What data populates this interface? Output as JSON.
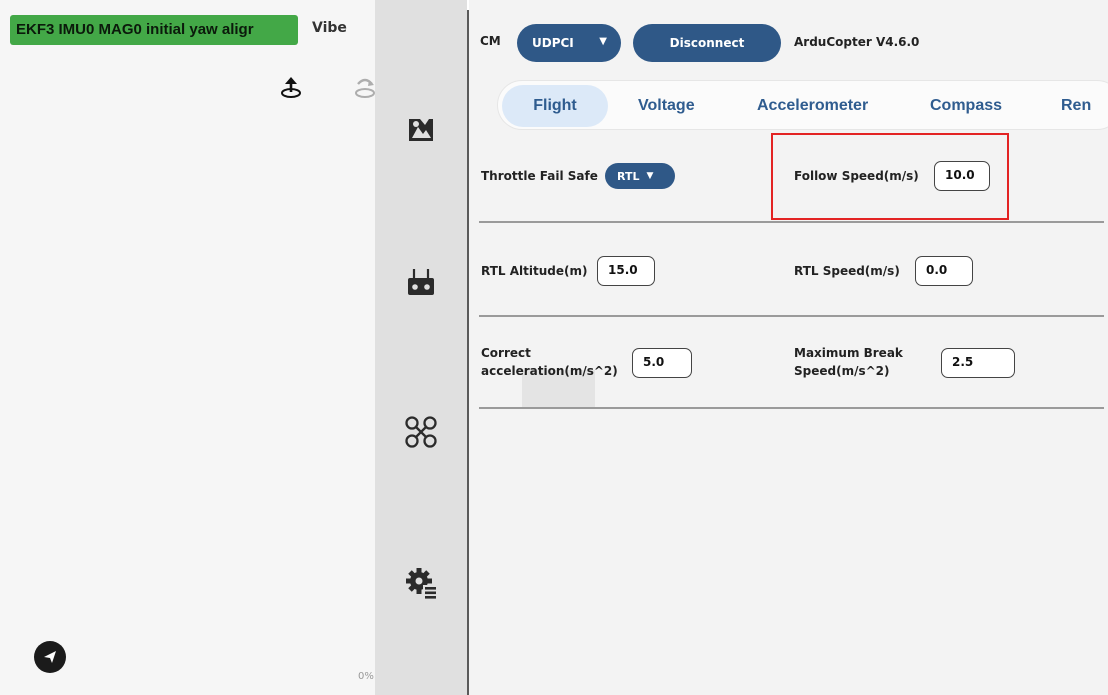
{
  "map": {
    "status_banner": "EKF3 IMU0 MAG0 initial yaw aligr",
    "vibe_label": "Vibe",
    "percent_label": "0%"
  },
  "icons": {
    "upload": "upload-icon",
    "rotate": "rotate-icon",
    "send": "send-icon",
    "setup": "setup-icon",
    "radio": "radio-controller-icon",
    "frame": "quadcopter-frame-icon",
    "parameters": "parameters-gear-icon"
  },
  "header": {
    "cm_label": "CM",
    "connection_select": "UDPCI",
    "disconnect_label": "Disconnect",
    "version": "ArduCopter V4.6.0"
  },
  "tabs": [
    "Flight",
    "Voltage",
    "Accelerometer",
    "Compass",
    "Ren"
  ],
  "active_tab": "Flight",
  "form": {
    "throttle_fail_safe": {
      "label": "Throttle Fail Safe",
      "value": "RTL"
    },
    "follow_speed": {
      "label": "Follow Speed(m/s)",
      "value": "10.0"
    },
    "rtl_altitude": {
      "label": "RTL Altitude(m)",
      "value": "15.0"
    },
    "rtl_speed": {
      "label": "RTL Speed(m/s)",
      "value": "0.0"
    },
    "correct_acceleration": {
      "label_line1": "Correct",
      "label_line2": "acceleration(m/s^2)",
      "value": "5.0"
    },
    "max_break_speed": {
      "label_line1": "Maximum Break",
      "label_line2": "Speed(m/s^2)",
      "value": "2.5"
    }
  },
  "colors": {
    "accent": "#2f5887",
    "banner": "#43a847",
    "active_tab_bg": "#dce9f8",
    "highlight": "#e32323"
  }
}
